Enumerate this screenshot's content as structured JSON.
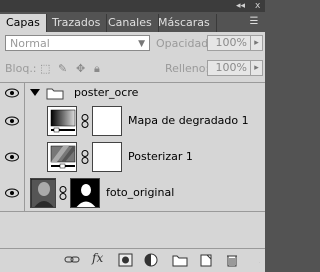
{
  "tabs": [
    {
      "label": "Capas",
      "active": true
    },
    {
      "label": "Trazados",
      "active": false
    },
    {
      "label": "Canales",
      "active": false
    },
    {
      "label": "Máscaras",
      "active": false
    }
  ],
  "window_controls": {
    "collapse": "◂◂",
    "close": "x"
  },
  "blend_mode": {
    "value": "Normal"
  },
  "opacity": {
    "label": "Opacidad:",
    "value": "100%"
  },
  "lock": {
    "label": "Bloq.:"
  },
  "fill": {
    "label": "Relleno:",
    "value": "100%"
  },
  "layers": [
    {
      "name": "poster_ocre",
      "type": "group",
      "visible": true,
      "expanded": true
    },
    {
      "name": "Mapa de degradado 1",
      "type": "adjustment",
      "visible": true
    },
    {
      "name": "Posterizar 1",
      "type": "adjustment",
      "visible": true
    },
    {
      "name": "foto_original",
      "type": "image-with-mask",
      "visible": true
    }
  ],
  "bottom_icons": [
    "link-layers-icon",
    "fx-icon",
    "add-mask-icon",
    "adjustment-layer-icon",
    "new-group-icon",
    "new-layer-icon",
    "delete-layer-icon"
  ],
  "bottom_labels": {
    "fx": "fx"
  },
  "colors": {
    "panel_bg": "#d6d6d6",
    "dark_chrome": "#535353",
    "selected_tab": "#d6d6d6"
  }
}
